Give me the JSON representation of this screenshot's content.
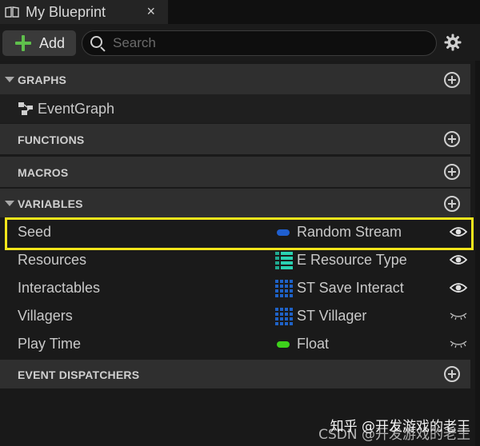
{
  "tab": {
    "title": "My Blueprint",
    "close_glyph": "×"
  },
  "toolbar": {
    "add_label": "Add",
    "search_placeholder": "Search",
    "search_value": ""
  },
  "sections": {
    "graphs": {
      "label": "GRAPHS",
      "items": [
        {
          "label": "EventGraph",
          "icon": "event-graph-icon"
        }
      ]
    },
    "functions": {
      "label": "FUNCTIONS"
    },
    "macros": {
      "label": "MACROS"
    },
    "variables": {
      "label": "VARIABLES",
      "items": [
        {
          "name": "Seed",
          "type": "Random Stream",
          "type_icon": "pill",
          "type_color": "#1f5fcf",
          "visible": true
        },
        {
          "name": "Resources",
          "type": "E Resource Type",
          "type_icon": "enum",
          "type_color": "#1fa98f",
          "visible": true
        },
        {
          "name": "Interactables",
          "type": "ST Save Interact",
          "type_icon": "grid",
          "type_color": "#1f62c7",
          "visible": true
        },
        {
          "name": "Villagers",
          "type": "ST Villager",
          "type_icon": "grid",
          "type_color": "#1f62c7",
          "visible": false
        },
        {
          "name": "Play Time",
          "type": "Float",
          "type_icon": "pill",
          "type_color": "#3ed21c",
          "visible": false
        }
      ]
    },
    "event_dispatchers": {
      "label": "EVENT DISPATCHERS"
    }
  },
  "highlight_color": "#f2e51b",
  "watermark": {
    "line1": "知乎 @开发游戏的老王",
    "line2": "CSDN @开发游戏的老王"
  }
}
